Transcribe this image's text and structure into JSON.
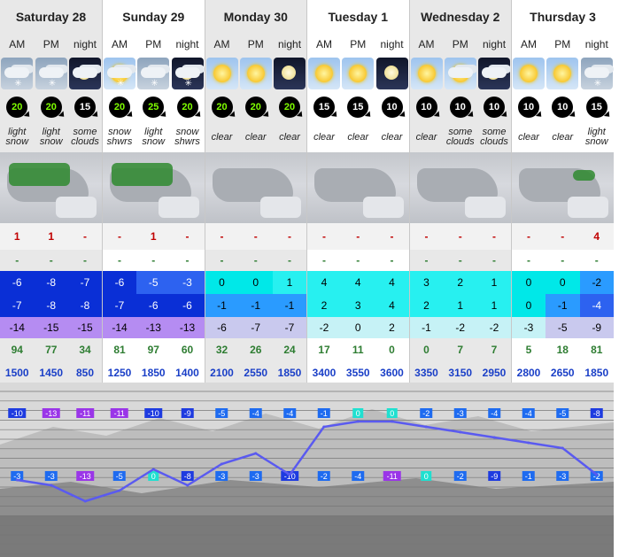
{
  "days": [
    "Saturday 28",
    "Sunday 29",
    "Monday 30",
    "Tuesday 1",
    "Wednesday 2",
    "Thursday 3"
  ],
  "periods": [
    "AM",
    "PM",
    "night",
    "AM",
    "PM",
    "night",
    "AM",
    "PM",
    "night",
    "AM",
    "PM",
    "night",
    "AM",
    "PM",
    "night",
    "AM",
    "PM",
    "night"
  ],
  "weather_icons": [
    "cloud-snow-icon",
    "cloud-snow-icon",
    "moon-cloud-icon",
    "sun-cloud-snow-icon",
    "cloud-snow-icon",
    "moon-cloud-snow-icon",
    "sun-icon",
    "sun-icon",
    "moon-icon",
    "sun-icon",
    "sun-icon",
    "moon-icon",
    "sun-icon",
    "sun-cloud-icon",
    "moon-cloud-icon",
    "sun-icon",
    "sun-icon",
    "cloud-snow-icon"
  ],
  "wind": [
    "20",
    "20",
    "15",
    "20",
    "25",
    "20",
    "20",
    "20",
    "20",
    "15",
    "15",
    "10",
    "10",
    "10",
    "10",
    "10",
    "10",
    "15"
  ],
  "wind_green": [
    true,
    true,
    false,
    true,
    true,
    true,
    true,
    true,
    true,
    false,
    false,
    false,
    false,
    false,
    false,
    false,
    false,
    false
  ],
  "summary": [
    [
      "light",
      "snow"
    ],
    [
      "light",
      "snow"
    ],
    [
      "some",
      "clouds"
    ],
    [
      "snow",
      "shwrs"
    ],
    [
      "light",
      "snow"
    ],
    [
      "snow",
      "shwrs"
    ],
    [
      "clear",
      ""
    ],
    [
      "clear",
      ""
    ],
    [
      "clear",
      ""
    ],
    [
      "clear",
      ""
    ],
    [
      "clear",
      ""
    ],
    [
      "clear",
      ""
    ],
    [
      "clear",
      ""
    ],
    [
      "some",
      "clouds"
    ],
    [
      "some",
      "clouds"
    ],
    [
      "clear",
      ""
    ],
    [
      "clear",
      ""
    ],
    [
      "light",
      "snow"
    ]
  ],
  "snow": [
    "1",
    "1",
    "-",
    "-",
    "1",
    "-",
    "-",
    "-",
    "-",
    "-",
    "-",
    "-",
    "-",
    "-",
    "-",
    "-",
    "-",
    "4"
  ],
  "rain": [
    "-",
    "-",
    "-",
    "-",
    "-",
    "-",
    "-",
    "-",
    "-",
    "-",
    "-",
    "-",
    "-",
    "-",
    "-",
    "-",
    "-",
    "-"
  ],
  "max_temp": [
    "-6",
    "-8",
    "-7",
    "-6",
    "-5",
    "-3",
    "0",
    "0",
    "1",
    "4",
    "4",
    "4",
    "3",
    "2",
    "1",
    "0",
    "0",
    "-2"
  ],
  "min_temp": [
    "-7",
    "-8",
    "-8",
    "-7",
    "-6",
    "-6",
    "-1",
    "-1",
    "-1",
    "2",
    "3",
    "4",
    "2",
    "1",
    "1",
    "0",
    "-1",
    "-4"
  ],
  "chill": [
    "-14",
    "-15",
    "-15",
    "-14",
    "-13",
    "-13",
    "-6",
    "-7",
    "-7",
    "-2",
    "0",
    "2",
    "-1",
    "-2",
    "-2",
    "-3",
    "-5",
    "-9"
  ],
  "humidity": [
    "94",
    "77",
    "34",
    "81",
    "97",
    "60",
    "32",
    "26",
    "24",
    "17",
    "11",
    "0",
    "0",
    "7",
    "7",
    "5",
    "18",
    "81"
  ],
  "freezing_level": [
    "1500",
    "1450",
    "850",
    "1250",
    "1850",
    "1400",
    "2100",
    "2550",
    "1850",
    "3400",
    "3550",
    "3600",
    "3350",
    "3150",
    "2950",
    "2800",
    "2650",
    "1850"
  ],
  "chart_data": {
    "type": "line",
    "upper_labels": [
      "-10",
      "-13",
      "-11",
      "-11",
      "-10",
      "-9",
      "-5",
      "-4",
      "-4",
      "-1",
      "0",
      "0",
      "-2",
      "-3",
      "-4",
      "-4",
      "-5",
      "-8"
    ],
    "lower_labels": [
      "-3",
      "-3",
      "-13",
      "-5",
      "0",
      "-8",
      "-3",
      "-3",
      "-10",
      "-2",
      "-4",
      "-11",
      "0",
      "-2",
      "-9",
      "-1",
      "-3",
      "-2"
    ],
    "line_values": [
      -7,
      -8,
      -11,
      -9,
      -5,
      -8,
      -4,
      -2,
      -6,
      3,
      4,
      4,
      3,
      2,
      1,
      0,
      -1,
      -6
    ]
  },
  "colors": {
    "cold_deep": "#0a2fd6",
    "cold": "#2d62f0",
    "cool": "#2a9bff",
    "zero": "#00e8e8",
    "warm": "#27f0f0",
    "chill_purple": "#b58cf2",
    "line": "#5a5af0"
  }
}
